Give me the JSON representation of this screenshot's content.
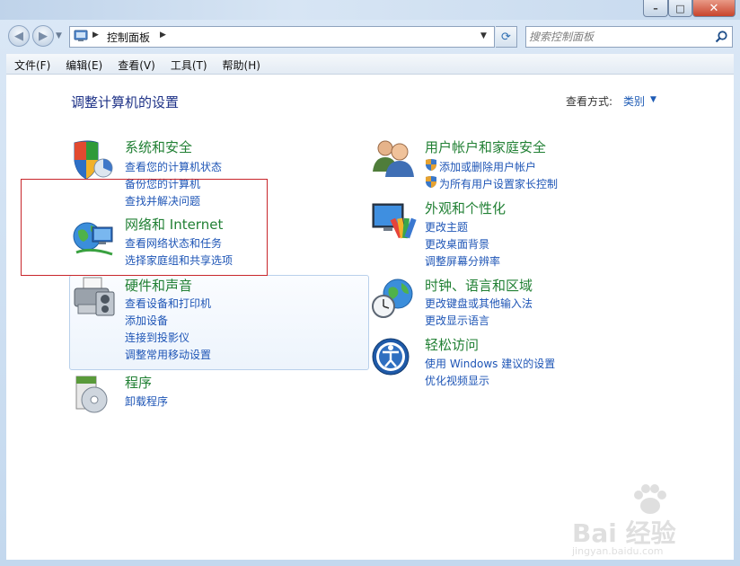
{
  "window": {
    "controls": {
      "minimize": "–",
      "maximize": "□",
      "close": "✕"
    }
  },
  "nav": {
    "address_crumb": "控制面板",
    "search_placeholder": "搜索控制面板"
  },
  "menu": [
    {
      "label": "文件(F)"
    },
    {
      "label": "编辑(E)"
    },
    {
      "label": "查看(V)"
    },
    {
      "label": "工具(T)"
    },
    {
      "label": "帮助(H)"
    }
  ],
  "content": {
    "title": "调整计算机的设置",
    "view_by_label": "查看方式:",
    "view_by_value": "类别"
  },
  "categories": {
    "system_security": {
      "icon": "shield-icon",
      "title": "系统和安全",
      "links": [
        "查看您的计算机状态",
        "备份您的计算机",
        "查找并解决问题"
      ]
    },
    "network": {
      "icon": "network-globe-icon",
      "title": "网络和 Internet",
      "links": [
        "查看网络状态和任务",
        "选择家庭组和共享选项"
      ]
    },
    "hardware": {
      "icon": "printer-icon",
      "title": "硬件和声音",
      "links": [
        "查看设备和打印机",
        "添加设备",
        "连接到投影仪",
        "调整常用移动设置"
      ]
    },
    "programs": {
      "icon": "programs-disc-icon",
      "title": "程序",
      "links": [
        "卸载程序"
      ]
    },
    "user_accounts": {
      "icon": "users-icon",
      "title": "用户帐户和家庭安全",
      "links": [
        "添加或删除用户帐户",
        "为所有用户设置家长控制"
      ]
    },
    "appearance": {
      "icon": "monitor-palette-icon",
      "title": "外观和个性化",
      "links": [
        "更改主题",
        "更改桌面背景",
        "调整屏幕分辨率"
      ]
    },
    "clock": {
      "icon": "clock-globe-icon",
      "title": "时钟、语言和区域",
      "links": [
        "更改键盘或其他输入法",
        "更改显示语言"
      ]
    },
    "ease": {
      "icon": "ease-of-access-icon",
      "title": "轻松访问",
      "links": [
        "使用 Windows 建议的设置",
        "优化视频显示"
      ]
    }
  },
  "watermark": {
    "brand": "Bai 经验",
    "url": "jingyan.baidu.com"
  }
}
